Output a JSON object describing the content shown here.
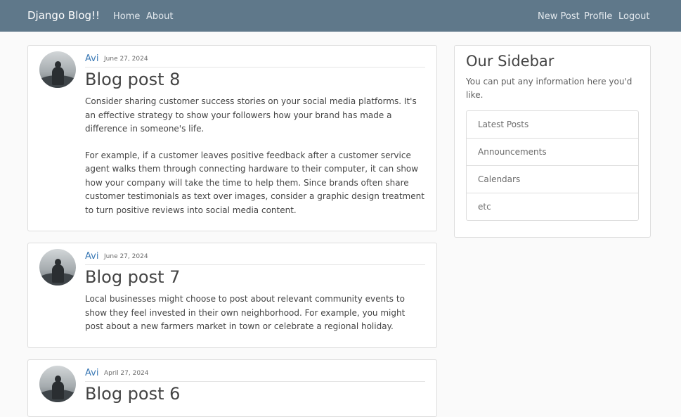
{
  "navbar": {
    "brand": "Django Blog!!",
    "left_links": [
      "Home",
      "About"
    ],
    "right_links": [
      "New Post",
      "Profile",
      "Logout"
    ]
  },
  "posts": [
    {
      "author": "Avi",
      "date": "June 27, 2024",
      "title": "Blog post 8",
      "paragraphs": [
        "Consider sharing customer success stories on your social media platforms. It's an effective strategy to show your followers how your brand has made a difference in someone's life.",
        "For example, if a customer leaves positive feedback after a customer service agent walks them through connecting hardware to their computer, it can show how your company will take the time to help them. Since brands often share customer testimonials as text over images, consider a graphic design treatment to turn positive reviews into social media content."
      ]
    },
    {
      "author": "Avi",
      "date": "June 27, 2024",
      "title": "Blog post 7",
      "paragraphs": [
        "Local businesses might choose to post about relevant community events to show they feel invested in their own neighborhood. For example, you might post about a new farmers market in town or celebrate a regional holiday."
      ]
    },
    {
      "author": "Avi",
      "date": "April 27, 2024",
      "title": "Blog post 6",
      "paragraphs": []
    }
  ],
  "sidebar": {
    "title": "Our Sidebar",
    "text": "You can put any information here you'd like.",
    "items": [
      "Latest Posts",
      "Announcements",
      "Calendars",
      "etc"
    ]
  }
}
